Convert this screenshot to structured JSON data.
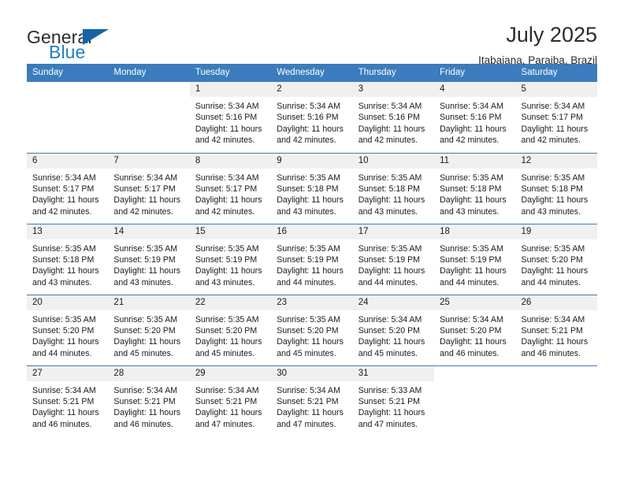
{
  "brand": {
    "name_top": "General",
    "name_bottom": "Blue",
    "triangle_color": "#1464a5",
    "blue_color": "#1f7ec4"
  },
  "header": {
    "title": "July 2025",
    "subtitle": "Itabaiana, Paraiba, Brazil"
  },
  "theme": {
    "header_blue": "#3a7cbe",
    "daynum_bg": "#f0f0f0"
  },
  "weekdays": [
    "Sunday",
    "Monday",
    "Tuesday",
    "Wednesday",
    "Thursday",
    "Friday",
    "Saturday"
  ],
  "weeks": [
    [
      {
        "day": "",
        "blank": true
      },
      {
        "day": "",
        "blank": true
      },
      {
        "day": "1",
        "sunrise": "Sunrise: 5:34 AM",
        "sunset": "Sunset: 5:16 PM",
        "daylight": "Daylight: 11 hours and 42 minutes."
      },
      {
        "day": "2",
        "sunrise": "Sunrise: 5:34 AM",
        "sunset": "Sunset: 5:16 PM",
        "daylight": "Daylight: 11 hours and 42 minutes."
      },
      {
        "day": "3",
        "sunrise": "Sunrise: 5:34 AM",
        "sunset": "Sunset: 5:16 PM",
        "daylight": "Daylight: 11 hours and 42 minutes."
      },
      {
        "day": "4",
        "sunrise": "Sunrise: 5:34 AM",
        "sunset": "Sunset: 5:16 PM",
        "daylight": "Daylight: 11 hours and 42 minutes."
      },
      {
        "day": "5",
        "sunrise": "Sunrise: 5:34 AM",
        "sunset": "Sunset: 5:17 PM",
        "daylight": "Daylight: 11 hours and 42 minutes."
      }
    ],
    [
      {
        "day": "6",
        "sunrise": "Sunrise: 5:34 AM",
        "sunset": "Sunset: 5:17 PM",
        "daylight": "Daylight: 11 hours and 42 minutes."
      },
      {
        "day": "7",
        "sunrise": "Sunrise: 5:34 AM",
        "sunset": "Sunset: 5:17 PM",
        "daylight": "Daylight: 11 hours and 42 minutes."
      },
      {
        "day": "8",
        "sunrise": "Sunrise: 5:34 AM",
        "sunset": "Sunset: 5:17 PM",
        "daylight": "Daylight: 11 hours and 42 minutes."
      },
      {
        "day": "9",
        "sunrise": "Sunrise: 5:35 AM",
        "sunset": "Sunset: 5:18 PM",
        "daylight": "Daylight: 11 hours and 43 minutes."
      },
      {
        "day": "10",
        "sunrise": "Sunrise: 5:35 AM",
        "sunset": "Sunset: 5:18 PM",
        "daylight": "Daylight: 11 hours and 43 minutes."
      },
      {
        "day": "11",
        "sunrise": "Sunrise: 5:35 AM",
        "sunset": "Sunset: 5:18 PM",
        "daylight": "Daylight: 11 hours and 43 minutes."
      },
      {
        "day": "12",
        "sunrise": "Sunrise: 5:35 AM",
        "sunset": "Sunset: 5:18 PM",
        "daylight": "Daylight: 11 hours and 43 minutes."
      }
    ],
    [
      {
        "day": "13",
        "sunrise": "Sunrise: 5:35 AM",
        "sunset": "Sunset: 5:18 PM",
        "daylight": "Daylight: 11 hours and 43 minutes."
      },
      {
        "day": "14",
        "sunrise": "Sunrise: 5:35 AM",
        "sunset": "Sunset: 5:19 PM",
        "daylight": "Daylight: 11 hours and 43 minutes."
      },
      {
        "day": "15",
        "sunrise": "Sunrise: 5:35 AM",
        "sunset": "Sunset: 5:19 PM",
        "daylight": "Daylight: 11 hours and 43 minutes."
      },
      {
        "day": "16",
        "sunrise": "Sunrise: 5:35 AM",
        "sunset": "Sunset: 5:19 PM",
        "daylight": "Daylight: 11 hours and 44 minutes."
      },
      {
        "day": "17",
        "sunrise": "Sunrise: 5:35 AM",
        "sunset": "Sunset: 5:19 PM",
        "daylight": "Daylight: 11 hours and 44 minutes."
      },
      {
        "day": "18",
        "sunrise": "Sunrise: 5:35 AM",
        "sunset": "Sunset: 5:19 PM",
        "daylight": "Daylight: 11 hours and 44 minutes."
      },
      {
        "day": "19",
        "sunrise": "Sunrise: 5:35 AM",
        "sunset": "Sunset: 5:20 PM",
        "daylight": "Daylight: 11 hours and 44 minutes."
      }
    ],
    [
      {
        "day": "20",
        "sunrise": "Sunrise: 5:35 AM",
        "sunset": "Sunset: 5:20 PM",
        "daylight": "Daylight: 11 hours and 44 minutes."
      },
      {
        "day": "21",
        "sunrise": "Sunrise: 5:35 AM",
        "sunset": "Sunset: 5:20 PM",
        "daylight": "Daylight: 11 hours and 45 minutes."
      },
      {
        "day": "22",
        "sunrise": "Sunrise: 5:35 AM",
        "sunset": "Sunset: 5:20 PM",
        "daylight": "Daylight: 11 hours and 45 minutes."
      },
      {
        "day": "23",
        "sunrise": "Sunrise: 5:35 AM",
        "sunset": "Sunset: 5:20 PM",
        "daylight": "Daylight: 11 hours and 45 minutes."
      },
      {
        "day": "24",
        "sunrise": "Sunrise: 5:34 AM",
        "sunset": "Sunset: 5:20 PM",
        "daylight": "Daylight: 11 hours and 45 minutes."
      },
      {
        "day": "25",
        "sunrise": "Sunrise: 5:34 AM",
        "sunset": "Sunset: 5:20 PM",
        "daylight": "Daylight: 11 hours and 46 minutes."
      },
      {
        "day": "26",
        "sunrise": "Sunrise: 5:34 AM",
        "sunset": "Sunset: 5:21 PM",
        "daylight": "Daylight: 11 hours and 46 minutes."
      }
    ],
    [
      {
        "day": "27",
        "sunrise": "Sunrise: 5:34 AM",
        "sunset": "Sunset: 5:21 PM",
        "daylight": "Daylight: 11 hours and 46 minutes."
      },
      {
        "day": "28",
        "sunrise": "Sunrise: 5:34 AM",
        "sunset": "Sunset: 5:21 PM",
        "daylight": "Daylight: 11 hours and 46 minutes."
      },
      {
        "day": "29",
        "sunrise": "Sunrise: 5:34 AM",
        "sunset": "Sunset: 5:21 PM",
        "daylight": "Daylight: 11 hours and 47 minutes."
      },
      {
        "day": "30",
        "sunrise": "Sunrise: 5:34 AM",
        "sunset": "Sunset: 5:21 PM",
        "daylight": "Daylight: 11 hours and 47 minutes."
      },
      {
        "day": "31",
        "sunrise": "Sunrise: 5:33 AM",
        "sunset": "Sunset: 5:21 PM",
        "daylight": "Daylight: 11 hours and 47 minutes."
      },
      {
        "day": "",
        "blank": true
      },
      {
        "day": "",
        "blank": true
      }
    ]
  ]
}
